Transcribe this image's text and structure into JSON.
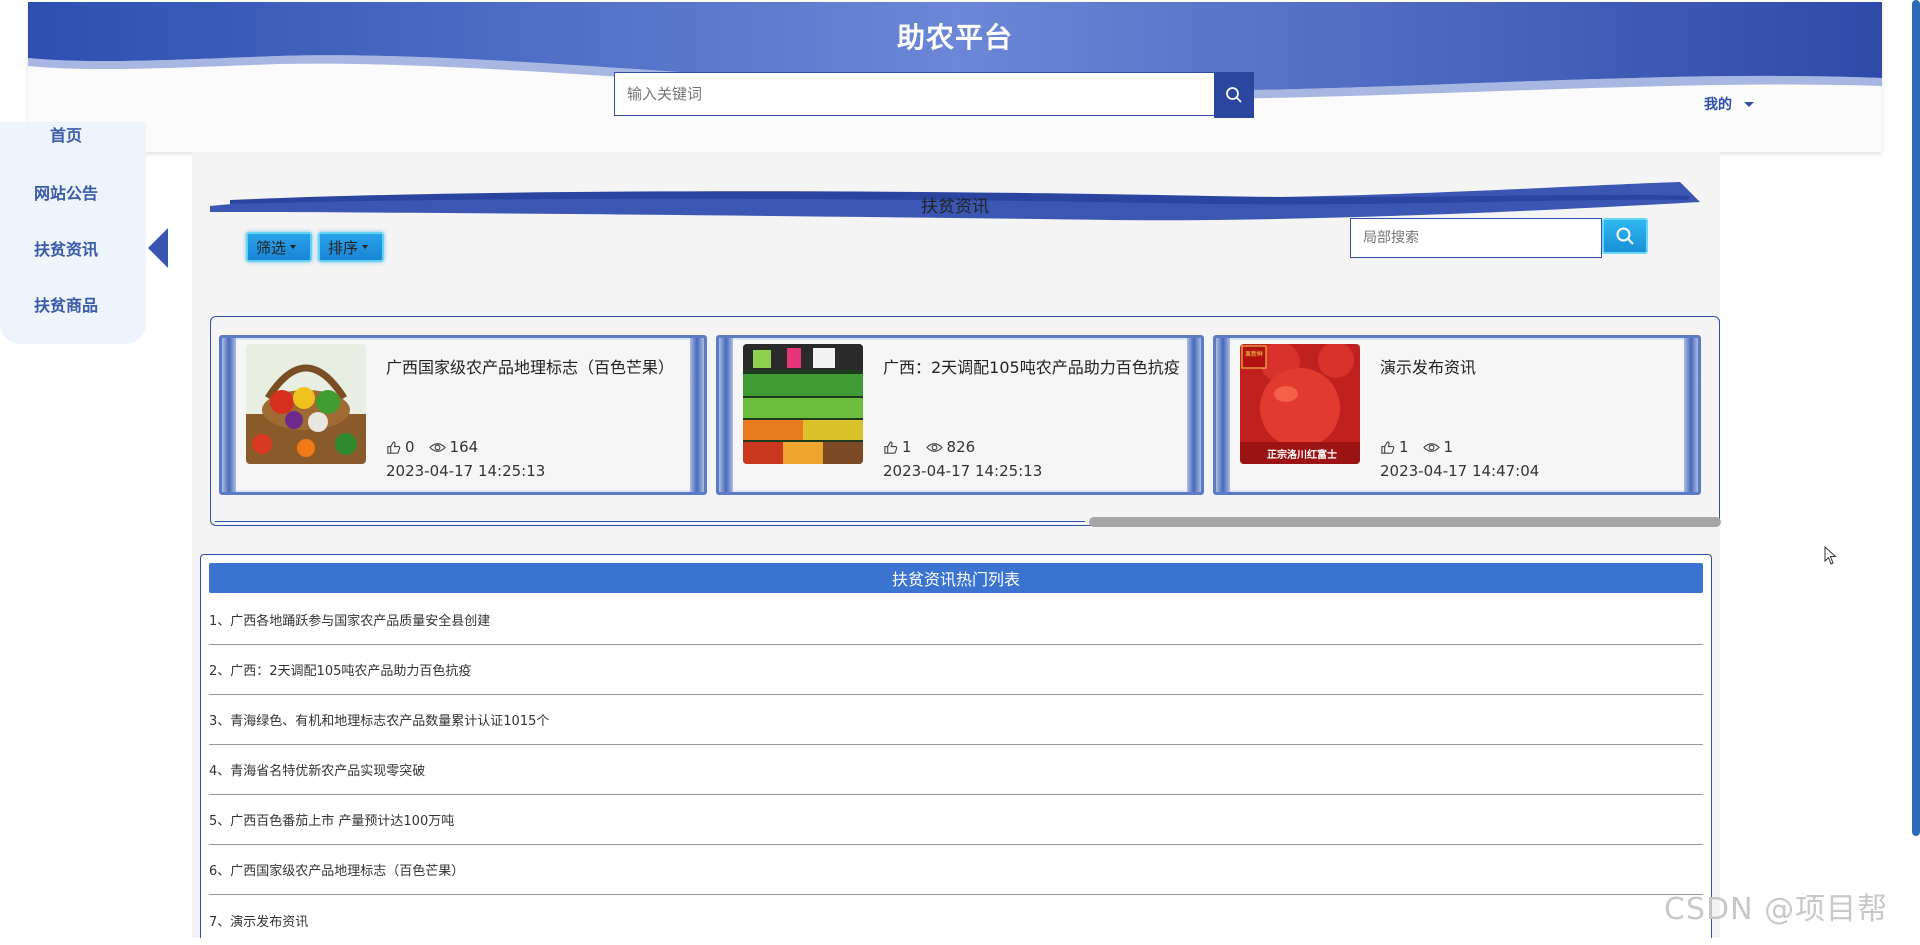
{
  "header": {
    "site_title": "助农平台",
    "search_placeholder": "输入关键词",
    "mine_label": "我的"
  },
  "sidenav": {
    "items": [
      {
        "label": "首页"
      },
      {
        "label": "网站公告"
      },
      {
        "label": "扶贫资讯",
        "active": true
      },
      {
        "label": "扶贫商品"
      }
    ]
  },
  "section": {
    "title": "扶贫资讯",
    "filter_label": "筛选",
    "sort_label": "排序",
    "local_search_placeholder": "局部搜索"
  },
  "cards": [
    {
      "title": "广西国家级农产品地理标志（百色芒果）",
      "likes": "0",
      "views": "164",
      "date": "2023-04-17 14:25:13",
      "image": "vegetable-basket"
    },
    {
      "title": "广西：2天调配105吨农产品助力百色抗疫",
      "likes": "1",
      "views": "826",
      "date": "2023-04-17 14:25:13",
      "image": "produce-shelves"
    },
    {
      "title": "演示发布资讯",
      "likes": "1",
      "views": "1",
      "date": "2023-04-17 14:47:04",
      "image": "red-apple",
      "image_text_top": "果新鲜",
      "image_text_bottom": "正宗洛川红富士"
    }
  ],
  "hot_list": {
    "title": "扶贫资讯热门列表",
    "items": [
      "1、广西各地踊跃参与国家农产品质量安全县创建",
      "2、广西：2天调配105吨农产品助力百色抗疫",
      "3、青海绿色、有机和地理标志农产品数量累计认证1015个",
      "4、青海省名特优新农产品实现零突破",
      "5、广西百色番茄上市 产量预计达100万吨",
      "6、广西国家级农产品地理标志（百色芒果）",
      "7、演示发布资讯"
    ]
  },
  "watermark": "CSDN @项目帮",
  "colors": {
    "primary": "#2f4fa8",
    "banner": "#3b56b3",
    "hot_header": "#3b73d1",
    "pill": "#1a84d6"
  }
}
